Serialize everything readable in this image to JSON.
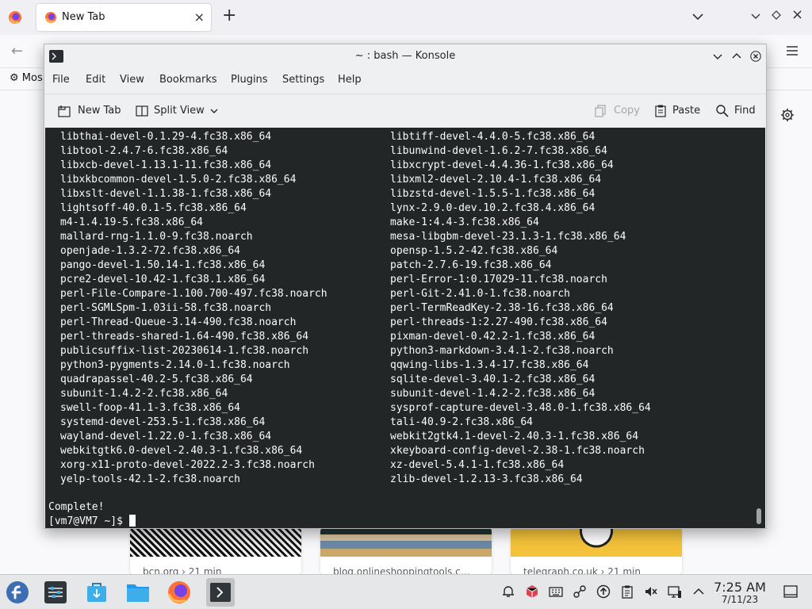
{
  "firefox": {
    "tab_title": "New Tab",
    "new_tab_symbol": "+",
    "tab_close_symbol": "×",
    "window_close_symbol": "×",
    "back_symbol": "←",
    "bookmark_item": "Mos",
    "cards": [
      {
        "label": "bcn.org › 21 min"
      },
      {
        "label": "blog.onlineshoppingtools.c…"
      },
      {
        "label": "telegraph.co.uk › 21 min"
      }
    ]
  },
  "konsole": {
    "title": "~ : bash — Konsole",
    "menu": [
      "File",
      "Edit",
      "View",
      "Bookmarks",
      "Plugins",
      "Settings",
      "Help"
    ],
    "toolbar": {
      "new_tab": "New Tab",
      "split_view": "Split View",
      "copy": "Copy",
      "paste": "Paste",
      "find": "Find"
    },
    "packages_left": [
      "libthai-devel-0.1.29-4.fc38.x86_64",
      "libtool-2.4.7-6.fc38.x86_64",
      "libxcb-devel-1.13.1-11.fc38.x86_64",
      "libxkbcommon-devel-1.5.0-2.fc38.x86_64",
      "libxslt-devel-1.1.38-1.fc38.x86_64",
      "lightsoff-40.0.1-5.fc38.x86_64",
      "m4-1.4.19-5.fc38.x86_64",
      "mallard-rng-1.1.0-9.fc38.noarch",
      "openjade-1.3.2-72.fc38.x86_64",
      "pango-devel-1.50.14-1.fc38.x86_64",
      "pcre2-devel-10.42-1.fc38.1.x86_64",
      "perl-File-Compare-1.100.700-497.fc38.noarch",
      "perl-SGMLSpm-1.03ii-58.fc38.noarch",
      "perl-Thread-Queue-3.14-490.fc38.noarch",
      "perl-threads-shared-1.64-490.fc38.x86_64",
      "publicsuffix-list-20230614-1.fc38.noarch",
      "python3-pygments-2.14.0-1.fc38.noarch",
      "quadrapassel-40.2-5.fc38.x86_64",
      "subunit-1.4.2-2.fc38.x86_64",
      "swell-foop-41.1-3.fc38.x86_64",
      "systemd-devel-253.5-1.fc38.x86_64",
      "wayland-devel-1.22.0-1.fc38.x86_64",
      "webkitgtk6.0-devel-2.40.3-1.fc38.x86_64",
      "xorg-x11-proto-devel-2022.2-3.fc38.noarch",
      "yelp-tools-42.1-2.fc38.noarch"
    ],
    "packages_right": [
      "libtiff-devel-4.4.0-5.fc38.x86_64",
      "libunwind-devel-1.6.2-7.fc38.x86_64",
      "libxcrypt-devel-4.4.36-1.fc38.x86_64",
      "libxml2-devel-2.10.4-1.fc38.x86_64",
      "libzstd-devel-1.5.5-1.fc38.x86_64",
      "lynx-2.9.0-dev.10.2.fc38.4.x86_64",
      "make-1:4.4-3.fc38.x86_64",
      "mesa-libgbm-devel-23.1.3-1.fc38.x86_64",
      "opensp-1.5.2-42.fc38.x86_64",
      "patch-2.7.6-19.fc38.x86_64",
      "perl-Error-1:0.17029-11.fc38.noarch",
      "perl-Git-2.41.0-1.fc38.noarch",
      "perl-TermReadKey-2.38-16.fc38.x86_64",
      "perl-threads-1:2.27-490.fc38.x86_64",
      "pixman-devel-0.42.2-1.fc38.x86_64",
      "python3-markdown-3.4.1-2.fc38.noarch",
      "qqwing-libs-1.3.4-17.fc38.x86_64",
      "sqlite-devel-3.40.1-2.fc38.x86_64",
      "subunit-devel-1.4.2-2.fc38.x86_64",
      "sysprof-capture-devel-3.48.0-1.fc38.x86_64",
      "tali-40.9-2.fc38.x86_64",
      "webkit2gtk4.1-devel-2.40.3-1.fc38.x86_64",
      "xkeyboard-config-devel-2.38-1.fc38.noarch",
      "xz-devel-5.4.1-1.fc38.x86_64",
      "zlib-devel-1.2.13-3.fc38.x86_64"
    ],
    "complete_text": "Complete!",
    "prompt": "[vm7@VM7 ~]$ "
  },
  "taskbar": {
    "time": "7:25 AM",
    "date": "7/11/23",
    "icons": [
      "fedora-launcher-icon",
      "system-settings-icon",
      "discover-store-icon",
      "dolphin-files-icon",
      "firefox-icon",
      "konsole-icon"
    ]
  },
  "colors": {
    "terminal_bg": "#232627",
    "terminal_fg": "#fcfcfc",
    "window_bg": "#eff0f1",
    "fedora_blue": "#3c6eb4"
  }
}
